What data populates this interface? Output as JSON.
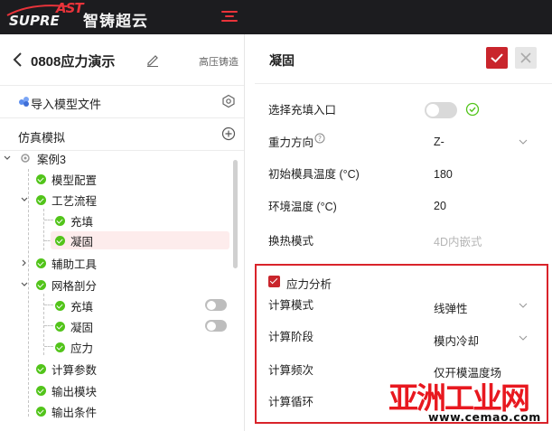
{
  "app": {
    "logo_prefix": "SUPRE",
    "logo_mark": "AST",
    "logo_name": "智铸超云"
  },
  "project": {
    "title": "0808应力演示",
    "tag": "高压铸造",
    "import_label": "导入模型文件",
    "sim_label": "仿真模拟"
  },
  "tree": {
    "root": "案例3",
    "model_config": "模型配置",
    "process": "工艺流程",
    "fill": "充填",
    "solidify": "凝固",
    "aux_tools": "辅助工具",
    "mesh": "网格剖分",
    "mesh_fill": "充填",
    "mesh_solidify": "凝固",
    "mesh_stress": "应力",
    "calc_params": "计算参数",
    "output_module": "输出模块",
    "output_conditions": "输出条件"
  },
  "panel": {
    "title": "凝固",
    "fields": {
      "fill_inlet_label": "选择充填入口",
      "gravity_label": "重力方向",
      "gravity_value": "Z-",
      "mold_temp_label": "初始模具温度 (°C)",
      "mold_temp_value": "180",
      "env_temp_label": "环境温度 (°C)",
      "env_temp_value": "20",
      "heat_mode_label": "换热模式",
      "heat_mode_value": "4D内嵌式"
    },
    "stress": {
      "enabled": true,
      "label": "应力分析",
      "calc_mode_label": "计算模式",
      "calc_mode_value": "线弹性",
      "calc_stage_label": "计算阶段",
      "calc_stage_value": "模内冷却",
      "calc_freq_label": "计算频次",
      "calc_freq_value": "仅开模温度场",
      "calc_cycle_label": "计算循环"
    }
  },
  "watermark": {
    "cn": "亚洲工业网",
    "url": "www.cemao.com"
  },
  "colors": {
    "topbar": "#1c1c1f",
    "brand_red": "#c9252c",
    "success_green": "#52c41a",
    "selection_bg": "#fdecec"
  }
}
